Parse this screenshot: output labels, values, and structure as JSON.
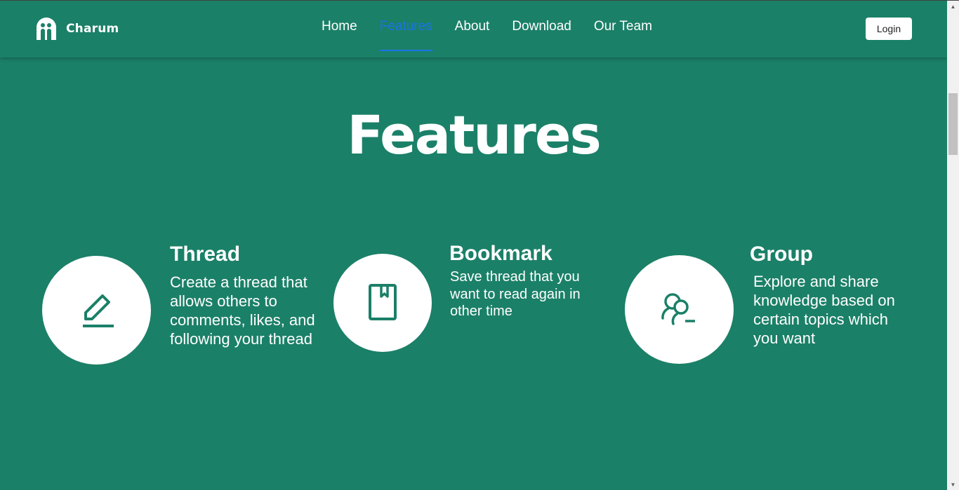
{
  "nav": {
    "brand": "Charum",
    "links": [
      {
        "label": "Home"
      },
      {
        "label": "Features",
        "active": true
      },
      {
        "label": "About"
      },
      {
        "label": "Download"
      },
      {
        "label": "Our Team"
      }
    ],
    "login_label": "Login",
    "active_color": "#1a73e8"
  },
  "main": {
    "title": "Features",
    "features": [
      {
        "icon": "pencil-icon",
        "title": "Thread",
        "description": "Create a thread that allows others to comments, likes, and following your thread"
      },
      {
        "icon": "bookmark-icon",
        "title": "Bookmark",
        "description": "Save thread that you want to read again in other time"
      },
      {
        "icon": "group-search-icon",
        "title": "Group",
        "description": "Explore and share knowledge based on certain topics which you want"
      }
    ]
  },
  "colors": {
    "background": "#1b8068",
    "text": "#ffffff",
    "circle": "#ffffff",
    "icon": "#1b8068"
  }
}
